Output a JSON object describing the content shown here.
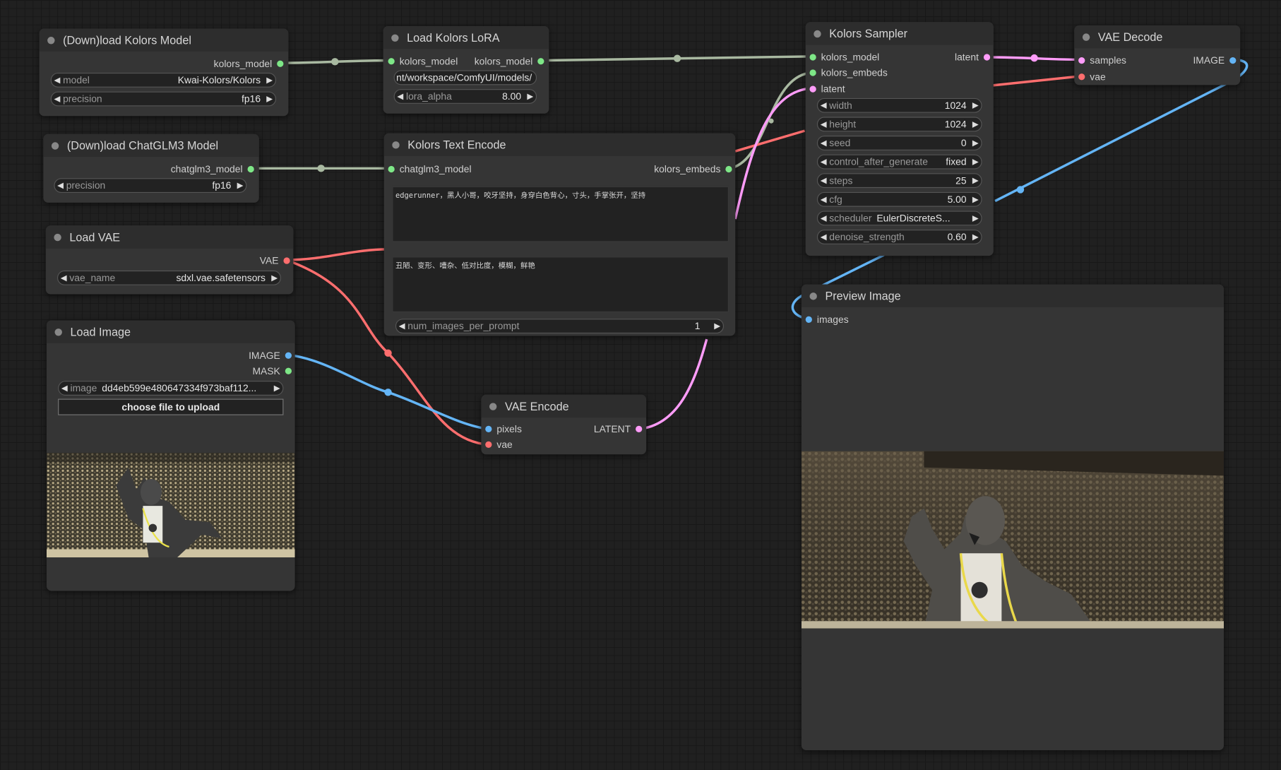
{
  "colors": {
    "model_link": "#a9b9a1",
    "clip_link": "#a9b9a1",
    "vae_link": "#ff6e6e",
    "image_link": "#64b5f6",
    "latent_link": "#ff9cf9",
    "embeds_link": "#a9b9a1"
  },
  "nodes": {
    "download_kolors": {
      "title": "(Down)load Kolors Model",
      "out_kolors_model": "kolors_model",
      "model_label": "model",
      "model_value": "Kwai-Kolors/Kolors",
      "precision_label": "precision",
      "precision_value": "fp16"
    },
    "download_chatglm": {
      "title": "(Down)load ChatGLM3 Model",
      "out_chatglm3_model": "chatglm3_model",
      "precision_label": "precision",
      "precision_value": "fp16"
    },
    "load_vae": {
      "title": "Load VAE",
      "out_vae": "VAE",
      "vae_name_label": "vae_name",
      "vae_name_value": "sdxl.vae.safetensors"
    },
    "load_image": {
      "title": "Load Image",
      "out_image": "IMAGE",
      "out_mask": "MASK",
      "image_label": "image",
      "image_value": "dd4eb599e480647334f973baf112...",
      "upload_button": "choose file to upload"
    },
    "load_lora": {
      "title": "Load Kolors LoRA",
      "in_kolors_model": "kolors_model",
      "out_kolors_model": "kolors_model",
      "path_value": "nt/workspace/ComfyUI/models/",
      "lora_alpha_label": "lora_alpha",
      "lora_alpha_value": "8.00"
    },
    "text_encode": {
      "title": "Kolors Text Encode",
      "in_chatglm3_model": "chatglm3_model",
      "out_kolors_embeds": "kolors_embeds",
      "prompt": "edgerunner，黑人小哥，咬牙坚持，身穿白色背心，寸头，手掌张开，坚持",
      "negative_prompt": "丑陋、变形、嘈杂、低对比度，模糊，鲜艳",
      "num_images_label": "num_images_per_prompt",
      "num_images_value": "1"
    },
    "vae_encode": {
      "title": "VAE Encode",
      "in_pixels": "pixels",
      "in_vae": "vae",
      "out_latent": "LATENT"
    },
    "sampler": {
      "title": "Kolors Sampler",
      "in_kolors_model": "kolors_model",
      "in_kolors_embeds": "kolors_embeds",
      "in_latent": "latent",
      "out_latent": "latent",
      "widgets": [
        {
          "label": "width",
          "value": "1024"
        },
        {
          "label": "height",
          "value": "1024"
        },
        {
          "label": "seed",
          "value": "0"
        },
        {
          "label": "control_after_generate",
          "value": "fixed"
        },
        {
          "label": "steps",
          "value": "25"
        },
        {
          "label": "cfg",
          "value": "5.00"
        },
        {
          "label": "scheduler",
          "value": "EulerDiscreteS..."
        },
        {
          "label": "denoise_strength",
          "value": "0.60"
        }
      ]
    },
    "vae_decode": {
      "title": "VAE Decode",
      "in_samples": "samples",
      "in_vae": "vae",
      "out_image": "IMAGE"
    },
    "preview": {
      "title": "Preview Image",
      "in_images": "images"
    }
  }
}
